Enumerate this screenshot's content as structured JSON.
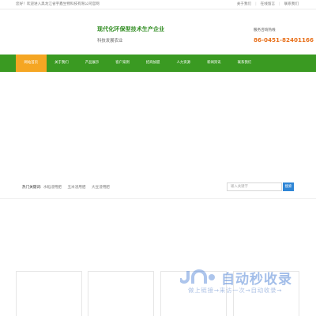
{
  "topbar": {
    "welcome": "您好！欢迎进入黑龙江省宇鑫生物科技有限公司官网",
    "links": [
      "关于我们",
      "在线留言",
      "联系我们"
    ]
  },
  "header": {
    "slogan_main": "现代化环保型技术生产企业",
    "slogan_sub": "科技发展农业",
    "hotline_label": "服务咨询热线",
    "hotline_number": "86-0451-82401166"
  },
  "nav": {
    "items": [
      "网站首页",
      "关于我们",
      "产品展示",
      "客户案例",
      "招商加盟",
      "人力资源",
      "新闻资讯",
      "联系我们"
    ],
    "active_index": 0,
    "colors": {
      "bar": "#3a9a22",
      "active": "#f5a623"
    }
  },
  "search": {
    "hot_label": "热门关键词:",
    "hot_keywords": [
      "水稻浸用肥",
      "玉米浸用肥",
      "大豆浸用肥"
    ],
    "placeholder": "输入关键字",
    "button_label": "搜索"
  },
  "watermark": {
    "title": "自动秒收录",
    "subtitle": "做上链接→来访一次→自动收录→"
  }
}
